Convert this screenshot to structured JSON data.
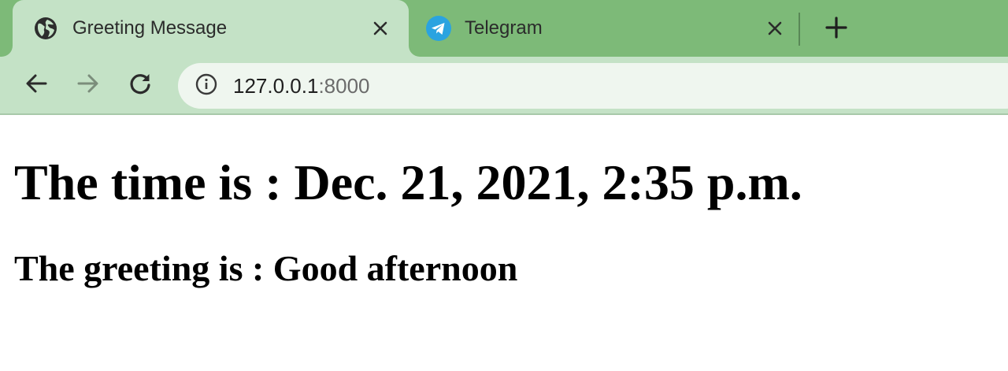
{
  "tabs": [
    {
      "title": "Greeting Message",
      "icon": "globe-icon",
      "active": true
    },
    {
      "title": "Telegram",
      "icon": "telegram-icon",
      "active": false
    }
  ],
  "new_tab_icon": "plus-icon",
  "toolbar": {
    "back_icon": "arrow-left-icon",
    "forward_icon": "arrow-right-icon",
    "reload_icon": "reload-icon",
    "site_info_icon": "info-icon",
    "url_host": "127.0.0.1",
    "url_port": ":8000"
  },
  "page": {
    "time_heading": "The time is : Dec. 21, 2021, 2:35 p.m.",
    "greeting_heading": "The greeting is : Good afternoon"
  },
  "colors": {
    "tabstrip": "#7dba78",
    "active_tab": "#c4e2c6",
    "omnibox": "#eff6ef",
    "telegram_blue": "#2aa3e0"
  }
}
